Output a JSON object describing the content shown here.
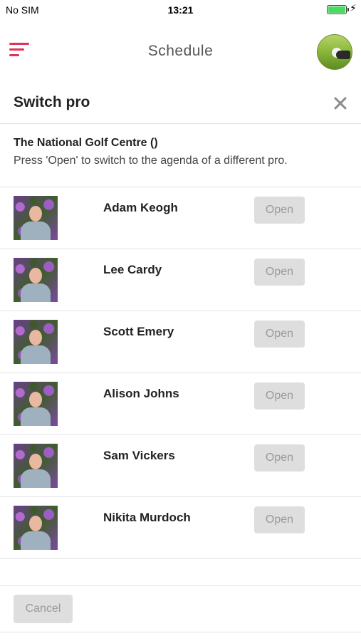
{
  "status_bar": {
    "carrier": "No SIM",
    "time": "13:21",
    "battery_color": "#4cd964"
  },
  "header": {
    "title": "Schedule",
    "menu_icon": "hamburger-menu-icon",
    "accent_color": "#e0335a"
  },
  "modal": {
    "title": "Switch pro",
    "close_icon": "close-icon",
    "info_title": "The National Golf Centre ()",
    "info_text": "Press 'Open' to switch to the agenda of a different pro."
  },
  "pros": [
    {
      "name": "Adam Keogh",
      "action": "Open"
    },
    {
      "name": "Lee Cardy",
      "action": "Open"
    },
    {
      "name": "Scott Emery",
      "action": "Open"
    },
    {
      "name": "Alison Johns",
      "action": "Open"
    },
    {
      "name": "Sam Vickers",
      "action": "Open"
    },
    {
      "name": "Nikita Murdoch",
      "action": "Open"
    }
  ],
  "footer": {
    "cancel_label": "Cancel"
  }
}
